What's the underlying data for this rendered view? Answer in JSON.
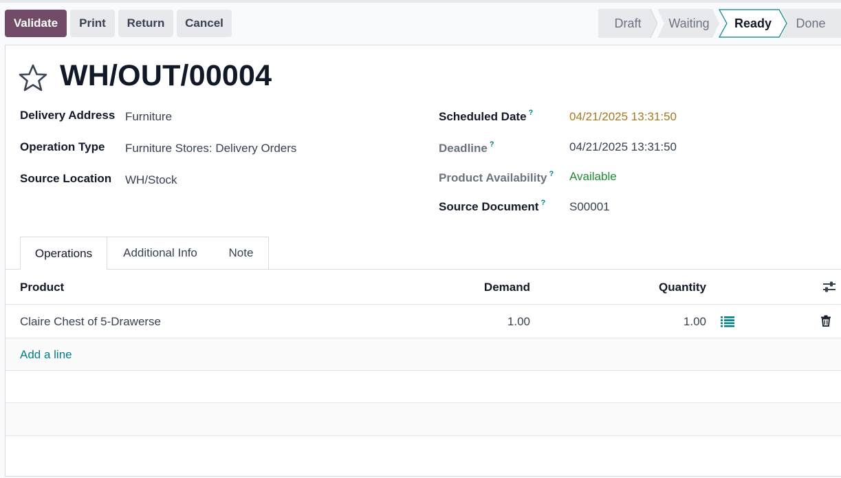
{
  "toolbar": {
    "validate_label": "Validate",
    "print_label": "Print",
    "return_label": "Return",
    "cancel_label": "Cancel"
  },
  "statusbar": {
    "stages": [
      "Draft",
      "Waiting",
      "Ready",
      "Done"
    ],
    "active": "Ready"
  },
  "record": {
    "name": "WH/OUT/00004",
    "fields_left": [
      {
        "label": "Delivery Address",
        "value": "Furniture"
      },
      {
        "label": "Operation Type",
        "value": "Furniture Stores: Delivery Orders"
      },
      {
        "label": "Source Location",
        "value": "WH/Stock"
      }
    ],
    "fields_right": [
      {
        "label": "Scheduled Date",
        "help": "?",
        "value": "04/21/2025 13:31:50"
      },
      {
        "label": "Deadline",
        "help": "?",
        "value": "04/21/2025 13:31:50"
      },
      {
        "label": "Product Availability",
        "help": "?",
        "value": "Available"
      },
      {
        "label": "Source Document",
        "help": "?",
        "value": "S00001"
      }
    ]
  },
  "tabs": [
    "Operations",
    "Additional Info",
    "Note"
  ],
  "operations": {
    "columns": {
      "product": "Product",
      "demand": "Demand",
      "quantity": "Quantity"
    },
    "rows": [
      {
        "product": "Claire Chest of 5-Drawerse",
        "demand": "1.00",
        "quantity": "1.00"
      }
    ],
    "add_line_label": "Add a line"
  },
  "colors": {
    "primary": "#714b67",
    "accent": "#017e84",
    "scheduled_date": "#a8781d",
    "available": "#1e8a34"
  },
  "icons": [
    "star-icon",
    "column-settings-icon",
    "detailed-operations-icon",
    "trash-icon"
  ]
}
